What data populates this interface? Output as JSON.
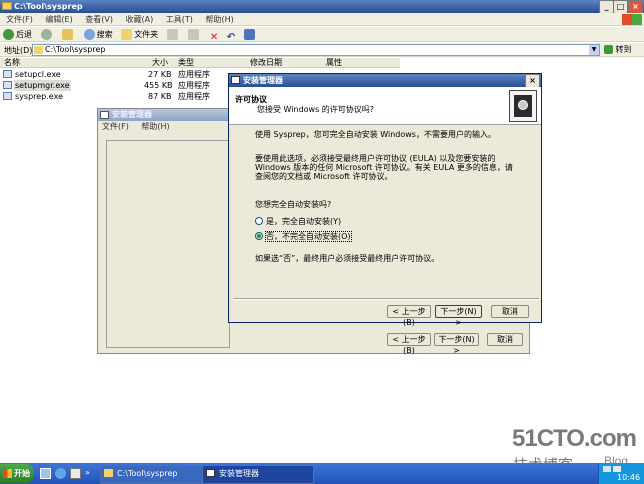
{
  "explorer": {
    "title": "C:\\Tool\\sysprep",
    "menu": [
      "文件(F)",
      "编辑(E)",
      "查看(V)",
      "收藏(A)",
      "工具(T)",
      "帮助(H)"
    ],
    "toolbar": {
      "back": "后退",
      "search": "搜索",
      "folders": "文件夹"
    },
    "address": {
      "label": "地址(D)",
      "value": "C:\\Tool\\sysprep",
      "go": "转到"
    },
    "columns": {
      "name": "名称",
      "size": "大小",
      "type": "类型",
      "modified": "修改日期",
      "attr": "属性"
    },
    "files": [
      {
        "name": "setupcl.exe",
        "size": "27 KB",
        "type": "应用程序"
      },
      {
        "name": "setupmgr.exe",
        "size": "455 KB",
        "type": "应用程序"
      },
      {
        "name": "sysprep.exe",
        "size": "87 KB",
        "type": "应用程序"
      }
    ]
  },
  "setup_back": {
    "title": "安装管理器",
    "menu": [
      "文件(F)",
      "帮助(H)"
    ],
    "back_button": "< 上一步(B)",
    "next_button": "下一步(N) >",
    "cancel_button": "取消"
  },
  "dialog": {
    "title": "安装管理器",
    "header_title": "许可协议",
    "header_subtitle": "您接受 Windows 的许可协议吗?",
    "para1": "使用 Sysprep，您可完全自动安装 Windows，不需要用户的输入。",
    "para2": "要使用此选项，必须接受最终用户许可协议 (EULA) 以及您要安装的 Windows 版本的任何 Microsoft 许可协议。有关 EULA 更多的信息，请查阅您的文档或 Microsoft 许可协议。",
    "question": "您想完全自动安装吗?",
    "option_yes": "是，完全自动安装(Y)",
    "option_no": "否，不完全自动安装(O)",
    "note": "如果选“否”，最终用户必须接受最终用户许可协议。",
    "back_button": "< 上一步(B)",
    "next_button": "下一步(N) >",
    "cancel_button": "取消"
  },
  "taskbar": {
    "start": "开始",
    "tasks": [
      "C:\\Tool\\sysprep",
      "安装管理器"
    ],
    "clock": "10:46"
  },
  "watermark": {
    "site": "51CTO.com",
    "blog": "技术博客",
    "blog_suffix": "Blog"
  }
}
